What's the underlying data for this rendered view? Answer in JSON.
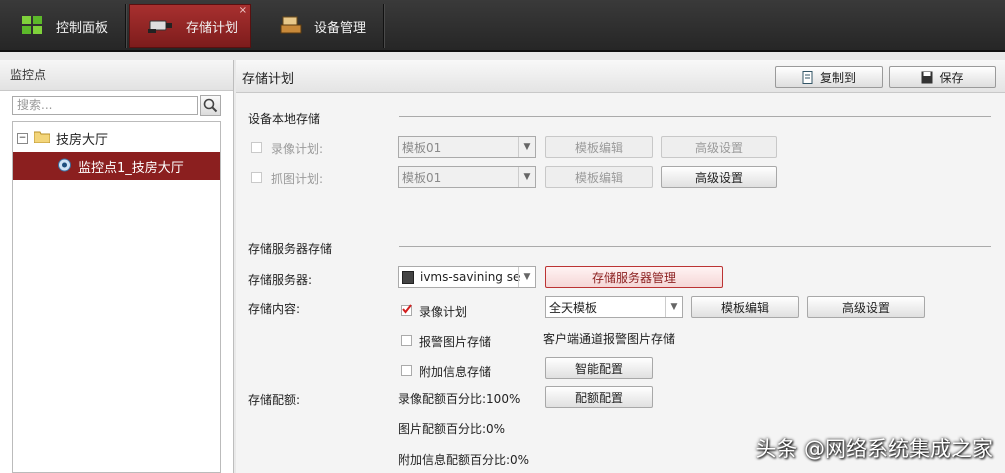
{
  "tabs": [
    {
      "label": "控制面板",
      "icon": "grid-icon"
    },
    {
      "label": "存储计划",
      "icon": "camera-icon",
      "active": true
    },
    {
      "label": "设备管理",
      "icon": "device-icon"
    }
  ],
  "left": {
    "header": "监控点",
    "search_placeholder": "搜索...",
    "tree": {
      "root_label": "技房大厅",
      "child_label": "监控点1_技房大厅"
    }
  },
  "main": {
    "title": "存储计划",
    "copy_label": "复制到",
    "save_label": "保存",
    "local": {
      "section": "设备本地存储",
      "record_label": "录像计划:",
      "record_template": "模板01",
      "capture_label": "抓图计划:",
      "capture_template": "模板01",
      "edit_label": "模板编辑",
      "advanced_label": "高级设置"
    },
    "server": {
      "section": "存储服务器存储",
      "server_label": "存储服务器:",
      "server_value": "ivms-savining ser",
      "server_manage_label": "存储服务器管理",
      "content_label": "存储内容:",
      "record_plan_label": "录像计划",
      "record_plan_checked": true,
      "record_template": "全天模板",
      "edit_label": "模板编辑",
      "advanced_label": "高级设置",
      "alarm_pic_label": "报警图片存储",
      "alarm_pic_checked": false,
      "alarm_pic_note": "客户端通道报警图片存储",
      "extra_info_label": "附加信息存储",
      "extra_info_checked": false,
      "smart_config_label": "智能配置",
      "quota_label": "存储配额:",
      "record_quota": "录像配额百分比:100%",
      "quota_config_label": "配额配置",
      "picture_quota": "图片配额百分比:0%",
      "extra_quota": "附加信息配额百分比:0%"
    }
  },
  "watermark": "头条 @网络系统集成之家",
  "colors": {
    "accent": "#8b1f1f",
    "topbar": "#2e2e2e"
  }
}
